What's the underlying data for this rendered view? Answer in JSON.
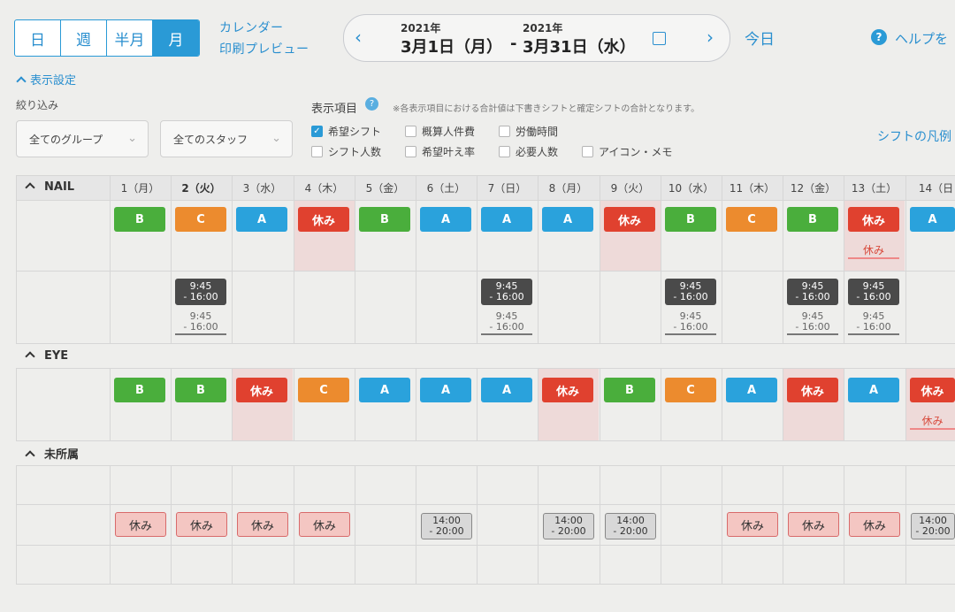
{
  "view_switch": [
    "日",
    "週",
    "半月",
    "月"
  ],
  "active_view": "月",
  "links": {
    "calendar": "カレンダー",
    "print_preview": "印刷プレビュー"
  },
  "date_nav": {
    "prev": "‹",
    "next": "›",
    "start_year": "2021年",
    "start_date": "3月1日（月）",
    "separator": "-",
    "end_year": "2021年",
    "end_date": "3月31日（水）"
  },
  "today": "今日",
  "help": {
    "icon": "?",
    "label": "ヘルプを"
  },
  "settings_toggle": "表示設定",
  "filter": {
    "label": "絞り込み",
    "group_select": "全てのグループ",
    "staff_select": "全てのスタッフ"
  },
  "display_items": {
    "label": "表示項目",
    "info_icon": "?",
    "note": "※各表示項目における合計値は下書きシフトと確定シフトの合計となります。",
    "checkboxes": [
      {
        "label": "希望シフト",
        "checked": true
      },
      {
        "label": "概算人件費",
        "checked": false
      },
      {
        "label": "労働時間",
        "checked": false
      },
      {
        "label": "シフト人数",
        "checked": false
      },
      {
        "label": "希望叶え率",
        "checked": false
      },
      {
        "label": "必要人数",
        "checked": false
      },
      {
        "label": "アイコン・メモ",
        "checked": false
      }
    ]
  },
  "legend_link": "シフトの凡例",
  "days": [
    "1（月）",
    "2（火）",
    "3（水）",
    "4（木）",
    "5（金）",
    "6（土）",
    "7（日）",
    "8（月）",
    "9（火）",
    "10（水）",
    "11（木）",
    "12（金）",
    "13（土）",
    "14（日"
  ],
  "groups": {
    "nail": {
      "label": "NAIL",
      "shifts": [
        "B",
        "C",
        "A",
        "休み",
        "B",
        "A",
        "A",
        "A",
        "休み",
        "B",
        "C",
        "B",
        "休み",
        "A"
      ],
      "shift_sub": [
        "",
        "",
        "",
        "",
        "",
        "",
        "",
        "",
        "",
        "",
        "",
        "",
        "休み",
        ""
      ],
      "confirmed": [
        {
          "day": 2,
          "start": "9:45",
          "end": "- 16:00"
        },
        {
          "day": 7,
          "start": "9:45",
          "end": "- 16:00"
        },
        {
          "day": 10,
          "start": "9:45",
          "end": "- 16:00"
        },
        {
          "day": 12,
          "start": "9:45",
          "end": "- 16:00"
        },
        {
          "day": 13,
          "start": "9:45",
          "end": "- 16:00"
        }
      ],
      "desired": [
        {
          "day": 2,
          "start": "9:45",
          "end": "- 16:00"
        },
        {
          "day": 7,
          "start": "9:45",
          "end": "- 16:00"
        },
        {
          "day": 10,
          "start": "9:45",
          "end": "- 16:00"
        },
        {
          "day": 12,
          "start": "9:45",
          "end": "- 16:00"
        },
        {
          "day": 13,
          "start": "9:45",
          "end": "- 16:00"
        }
      ]
    },
    "eye": {
      "label": "EYE",
      "shifts": [
        "B",
        "B",
        "休み",
        "C",
        "A",
        "A",
        "A",
        "休み",
        "B",
        "C",
        "A",
        "休み",
        "A",
        "休み"
      ],
      "shift_sub": [
        "",
        "",
        "",
        "",
        "",
        "",
        "",
        "",
        "",
        "",
        "",
        "",
        "",
        "休み"
      ]
    },
    "unassigned": {
      "label": "未所属",
      "cells": [
        {
          "day": 1,
          "type": "off",
          "text": "休み"
        },
        {
          "day": 2,
          "type": "off",
          "text": "休み"
        },
        {
          "day": 3,
          "type": "off",
          "text": "休み"
        },
        {
          "day": 4,
          "type": "off",
          "text": "休み"
        },
        {
          "day": 6,
          "type": "time",
          "start": "14:00",
          "end": "- 20:00"
        },
        {
          "day": 8,
          "type": "time",
          "start": "14:00",
          "end": "- 20:00"
        },
        {
          "day": 9,
          "type": "time",
          "start": "14:00",
          "end": "- 20:00"
        },
        {
          "day": 11,
          "type": "off",
          "text": "休み"
        },
        {
          "day": 12,
          "type": "off",
          "text": "休み"
        },
        {
          "day": 13,
          "type": "off",
          "text": "休み"
        },
        {
          "day": 14,
          "type": "time",
          "start": "14:00",
          "end": "- 20:00"
        }
      ]
    }
  }
}
